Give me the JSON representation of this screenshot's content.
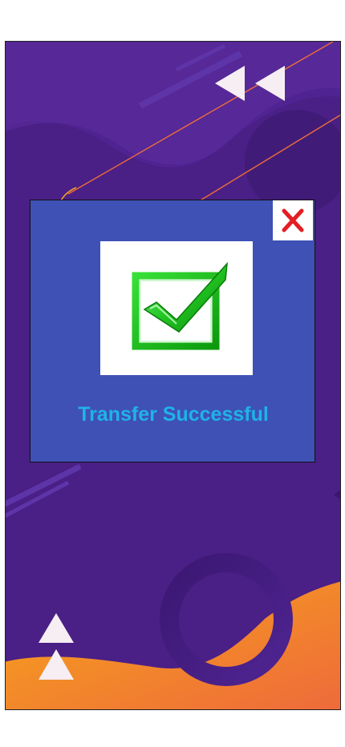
{
  "dialog": {
    "message": "Transfer Successful",
    "close_icon": "close-icon",
    "success_icon": "checkmark-icon"
  },
  "colors": {
    "background_purple": "#4a1f86",
    "wave_purple": "#5b2b96",
    "dialog_blue": "#3f51b5",
    "message_cyan": "#1fb3e6",
    "close_red": "#e31e24",
    "check_green": "#22c422",
    "accent_orange": "#f39c12"
  }
}
